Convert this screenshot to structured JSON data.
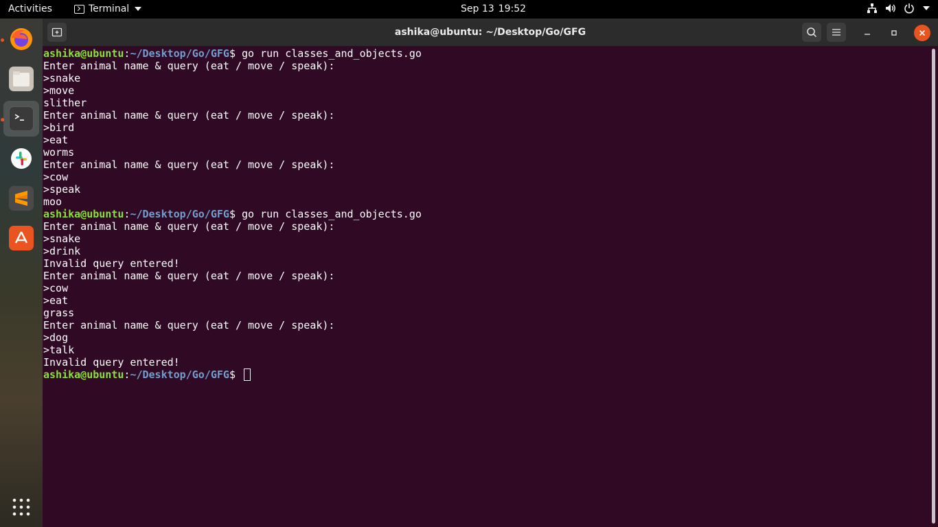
{
  "topbar": {
    "activities": "Activities",
    "app_name": "Terminal",
    "date": "Sep 13",
    "time": "19:52",
    "icons": [
      "network-icon",
      "volume-icon",
      "power-icon",
      "chevron-down-icon"
    ]
  },
  "dock": {
    "items": [
      {
        "name": "firefox",
        "icon": "firefox-icon"
      },
      {
        "name": "files",
        "icon": "files-icon"
      },
      {
        "name": "terminal",
        "icon": "terminal-icon",
        "active": true
      },
      {
        "name": "slack",
        "icon": "slack-icon"
      },
      {
        "name": "sublime-text",
        "icon": "sublime-icon"
      },
      {
        "name": "software",
        "icon": "app-store-icon"
      }
    ],
    "show_apps": "grid-icon"
  },
  "window": {
    "title": "ashika@ubuntu: ~/Desktop/Go/GFG"
  },
  "terminal": {
    "prompt_user": "ashika@ubuntu",
    "prompt_sep": ":",
    "prompt_path": "~/Desktop/Go/GFG",
    "prompt_end": "$ ",
    "lines": [
      {
        "kind": "prompt",
        "cmd": "go run classes_and_objects.go"
      },
      {
        "kind": "out",
        "text": "Enter animal name & query (eat / move / speak):"
      },
      {
        "kind": "out",
        "text": ">snake"
      },
      {
        "kind": "out",
        "text": ">move"
      },
      {
        "kind": "out",
        "text": "slither"
      },
      {
        "kind": "out",
        "text": "Enter animal name & query (eat / move / speak):"
      },
      {
        "kind": "out",
        "text": ">bird"
      },
      {
        "kind": "out",
        "text": ">eat"
      },
      {
        "kind": "out",
        "text": "worms"
      },
      {
        "kind": "out",
        "text": "Enter animal name & query (eat / move / speak):"
      },
      {
        "kind": "out",
        "text": ">cow"
      },
      {
        "kind": "out",
        "text": ">speak"
      },
      {
        "kind": "out",
        "text": "moo"
      },
      {
        "kind": "prompt",
        "cmd": "go run classes_and_objects.go"
      },
      {
        "kind": "out",
        "text": "Enter animal name & query (eat / move / speak):"
      },
      {
        "kind": "out",
        "text": ">snake"
      },
      {
        "kind": "out",
        "text": ">drink"
      },
      {
        "kind": "out",
        "text": "Invalid query entered!"
      },
      {
        "kind": "out",
        "text": "Enter animal name & query (eat / move / speak):"
      },
      {
        "kind": "out",
        "text": ">cow"
      },
      {
        "kind": "out",
        "text": ">eat"
      },
      {
        "kind": "out",
        "text": "grass"
      },
      {
        "kind": "out",
        "text": "Enter animal name & query (eat / move / speak):"
      },
      {
        "kind": "out",
        "text": ">dog"
      },
      {
        "kind": "out",
        "text": ">talk"
      },
      {
        "kind": "out",
        "text": "Invalid query entered!"
      },
      {
        "kind": "prompt",
        "cmd": "",
        "cursor": true
      }
    ]
  },
  "colors": {
    "terminal_bg": "#300a24",
    "prompt_user": "#8ae234",
    "prompt_path": "#729fcf",
    "accent": "#e95420"
  }
}
